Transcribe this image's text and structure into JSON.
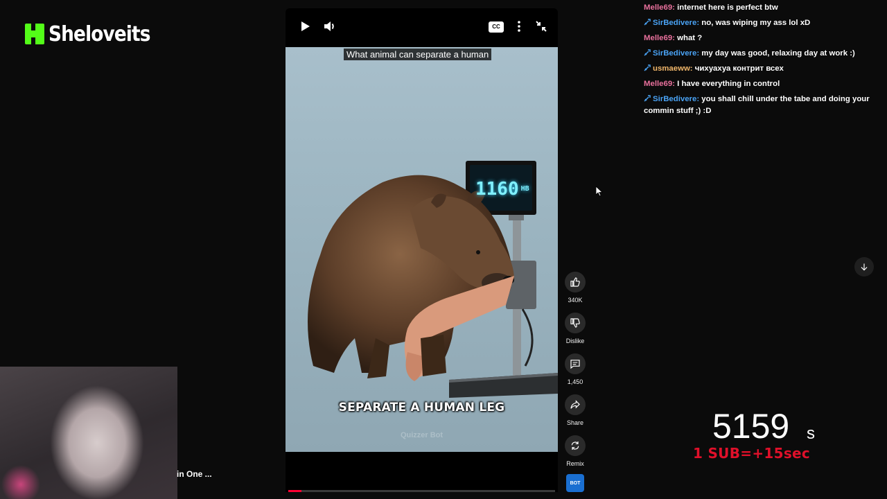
{
  "stream": {
    "brand_text": "Sheloveits",
    "accent_color": "#53fc18"
  },
  "player": {
    "caption_top": "What animal can separate a human",
    "caption_bottom": "SEPARATE A HUMAN LEG",
    "watermark": "Quizzer Bot",
    "scale_display": "1160",
    "scale_unit": "HB",
    "progress_fraction": 0.05,
    "controls": [
      "play-icon",
      "volume-icon",
      "closed-captions-icon",
      "more-options-icon",
      "collapse-icon"
    ],
    "cc_label": "CC"
  },
  "actions": {
    "like_count": "340K",
    "dislike_label": "Dislike",
    "comments_count": "1,450",
    "share_label": "Share",
    "remix_label": "Remix",
    "channel_badge": "BOT"
  },
  "chat": {
    "messages": [
      {
        "user": "Melle69:",
        "text": "internet here is perfect btw",
        "badge": false,
        "color": "#e8709c"
      },
      {
        "user": "SirBedivere:",
        "text": "no, was wiping my ass lol xD",
        "badge": true,
        "color": "#4aa3f5"
      },
      {
        "user": "Melle69:",
        "text": "what ?",
        "badge": false,
        "color": "#e8709c"
      },
      {
        "user": "SirBedivere:",
        "text": "my day was good, relaxing day at work :)",
        "badge": true,
        "color": "#4aa3f5"
      },
      {
        "user": "usmaeww:",
        "text": "чихуахуа контрит всех",
        "badge": true,
        "color": "#f0b66a"
      },
      {
        "user": "Melle69:",
        "text": "I have everything in control",
        "badge": false,
        "color": "#e8709c"
      },
      {
        "user": "SirBedivere:",
        "text": "you shall chill under the tabe and doing your commin stuff ;) :D",
        "badge": true,
        "color": "#4aa3f5"
      }
    ]
  },
  "timer": {
    "value": "5159",
    "unit": "s",
    "rule": "1 SUB=+15sec"
  },
  "overlay": {
    "cut_title": "in One ..."
  }
}
